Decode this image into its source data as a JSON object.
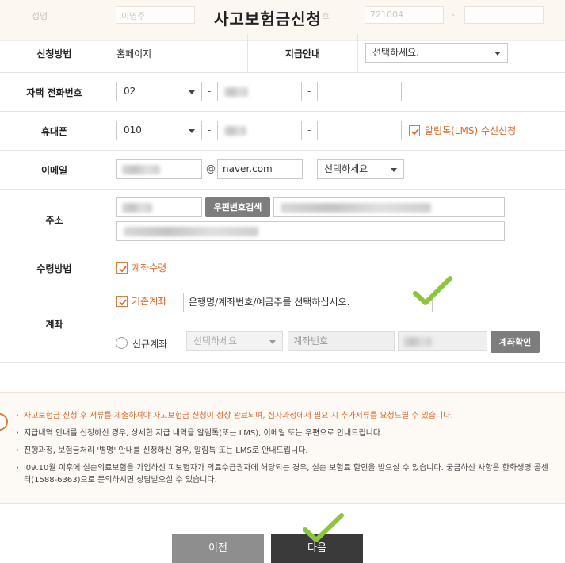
{
  "header": {
    "title": "사고보험금신청",
    "ghost_name_label": "성명",
    "ghost_name_value": "이영주",
    "ghost_id_label": "호",
    "ghost_id_value": "721004",
    "ghost_dash": "-"
  },
  "form": {
    "apply_method": {
      "label": "신청방법",
      "value": "홈페이지"
    },
    "payment_notice": {
      "label": "지급안내",
      "select_value": "선택하세요."
    },
    "home_phone": {
      "label": "자택 전화번호",
      "area_code": "02",
      "sep": "-"
    },
    "mobile": {
      "label": "휴대폰",
      "prefix": "010",
      "sep": "-",
      "alimtalk_label": "알림톡(LMS) 수신신청",
      "alimtalk_checked": true
    },
    "email": {
      "label": "이메일",
      "at": "@",
      "domain": "naver.com",
      "domain_select": "선택하세요"
    },
    "address": {
      "label": "주소",
      "search_button": "우편번호검색"
    },
    "receive_method": {
      "label": "수령방법",
      "option_label": "계좌수령",
      "checked": true
    },
    "account": {
      "label": "계좌",
      "existing_label": "기존계좌",
      "existing_checked": true,
      "existing_value": "은행명/계좌번호/예금주를 선택하십시오.",
      "new_label": "신규계좌",
      "new_bank_select": "선택하세요",
      "new_account_placeholder": "계좌번호",
      "verify_button": "계좌확인"
    }
  },
  "notices": [
    {
      "text": "사고보험금 신청 후 서류를 제출하셔야 사고보험금 신청이 정상 완료되며, 심사과정에서 필요 시 추가서류를 요청드릴 수 있습니다.",
      "highlight": true
    },
    {
      "text": "지급내역 안내를 신청하신 경우, 상세한 지급 내역을 알림톡(또는 LMS), 이메일 또는 우편으로 안내드립니다.",
      "highlight": false
    },
    {
      "text": "진행과정, 보험금처리 '병명' 안내를 신청하신 경우, 알림톡 또는 LMS로 안내드립니다.",
      "highlight": false
    },
    {
      "text": "'09.10월 이후에 실손의료보험을 가입하신 피보험자가 의료수급권자에 해당되는 경우, 실손 보험료 할인을 받으실 수 있습니다. 궁금하신 사항은 한화생명 콜센터(1588-6363)으로 문의하시면 상담받으실 수 있습니다.",
      "highlight": false
    }
  ],
  "buttons": {
    "prev": "이전",
    "next": "다음"
  },
  "colors": {
    "accent": "#e0662a",
    "check_green": "#8cc63f",
    "next_bg": "#3a3a3a",
    "prev_bg": "#8e8e8e"
  }
}
